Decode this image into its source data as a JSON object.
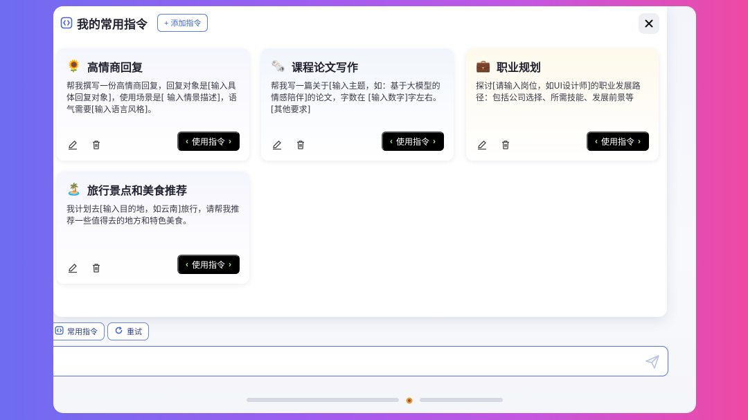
{
  "header": {
    "title": "我的常用指令",
    "add_button": "+ 添加指令"
  },
  "cards": [
    {
      "emoji": "🌻",
      "title": "高情商回复",
      "description": "帮我撰写一份高情商回复，回复对象是[输入具体回复对象]，使用场景是[ 输入情景描述]，语气需要[输入语言风格]。",
      "use_button": "使用指令"
    },
    {
      "emoji": "🗞️",
      "title": "课程论文写作",
      "description": "帮我写一篇关于[输入主题，如：基于大模型的情感陪伴]的论文，字数在 [输入数字]字左右。[其他要求]",
      "use_button": "使用指令"
    },
    {
      "emoji": "💼",
      "title": "职业规划",
      "description": "探讨[请输入岗位，如UI设计师]的职业发展路径：包括公司选择、所需技能、发展前景等",
      "use_button": "使用指令"
    },
    {
      "emoji": "🏝️",
      "title": "旅行景点和美食推荐",
      "description": "我计划去[输入目的地，如云南]旅行，请帮我推荐一些值得去的地方和特色美食。",
      "use_button": "使用指令"
    }
  ],
  "toolbar": {
    "common_label": "常用指令",
    "retry_label": "重试"
  },
  "icons": {
    "panel": "command-icon",
    "close": "close-icon",
    "edit": "edit-icon",
    "delete": "trash-icon",
    "common": "command-icon",
    "retry": "refresh-icon",
    "send": "send-icon"
  },
  "colors": {
    "accent": "#3c62d8",
    "button_bg": "#000000",
    "chevron": "#a7f070"
  }
}
